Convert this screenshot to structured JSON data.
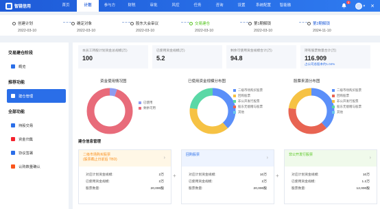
{
  "app": {
    "logo": "智链信用"
  },
  "nav": [
    "首页",
    "计划",
    "参与方",
    "财税",
    "审批",
    "风控",
    "任务",
    "咨询",
    "设置",
    "系统配置",
    "智能融"
  ],
  "header": {
    "bell_count": "5",
    "close_symbol": "✕",
    "caret": "▾"
  },
  "steps": [
    {
      "title": "创建计划",
      "date": "2022-03-10",
      "state": ""
    },
    {
      "title": "确定对象",
      "date": "2022-03-10",
      "state": ""
    },
    {
      "title": "股东大会审议",
      "date": "2022-03-10",
      "state": ""
    },
    {
      "title": "交易建仓",
      "date": "2022-03-10",
      "state": "done"
    },
    {
      "title": "第1期解锁",
      "date": "2022-03-10",
      "state": ""
    },
    {
      "title": "第2期解锁",
      "date": "2024-11-10",
      "state": "cur"
    }
  ],
  "sidebar": {
    "group1": "交易建仓阶段",
    "group2": "推荐功能",
    "group3": "全部功能",
    "items": [
      {
        "label": "概览",
        "group": 1,
        "color": "#2a6ee8",
        "icon": "home-icon"
      },
      {
        "label": "建仓管理",
        "group": 2,
        "color": "#ffffff",
        "icon": "grid-icon",
        "active": true
      },
      {
        "label": "持股交易",
        "group": 3,
        "color": "#2a6ee8",
        "icon": "trade-icon"
      },
      {
        "label": "资金归集",
        "group": 3,
        "color": "#f5222d",
        "icon": "fund-icon"
      },
      {
        "label": "协议签署",
        "group": 3,
        "color": "#2a6ee8",
        "icon": "sign-icon"
      },
      {
        "label": "认购数量确认",
        "group": 3,
        "color": "#fa541c",
        "icon": "confirm-icon"
      }
    ]
  },
  "stats": [
    {
      "label": "本员工持股计划资金总规模(万)",
      "value": "100",
      "sub": ""
    },
    {
      "label": "已使用资金规模(万)",
      "value": "5.2",
      "sub": ""
    },
    {
      "label": "剩余可使用资金规模合计(万)",
      "value": "94.8",
      "sub": ""
    },
    {
      "label": "持有股票数量合计(万)",
      "value": "116.909",
      "sub": "占公司总股本约1.04%"
    }
  ],
  "charts": [
    {
      "title": "资金使用情况图",
      "legend": [
        "已使用",
        "剩余可用"
      ]
    },
    {
      "title": "已使用资金规模分布图",
      "legend": [
        "二级市场购买股票",
        "回购股票",
        "非公开发行股票",
        "股东无偿赠与股票",
        "其他"
      ]
    },
    {
      "title": "股票来源分布图",
      "legend": [
        "二级市场购买股票",
        "回购股票",
        "非公开发行股票",
        "股东无偿赠与股票",
        "其他"
      ]
    }
  ],
  "chart_data": [
    {
      "type": "pie",
      "title": "资金使用情况图",
      "categories": [
        "已使用",
        "剩余可用"
      ],
      "values": [
        5.2,
        94.8
      ]
    },
    {
      "type": "pie",
      "title": "已使用资金规模分布图",
      "categories": [
        "二级市场购买股票",
        "回购股票",
        "非公开发行股票"
      ],
      "values": [
        2,
        2,
        1.2
      ]
    },
    {
      "type": "pie",
      "title": "股票来源分布图",
      "categories": [
        "二级市场购买股票",
        "回购股票",
        "非公开发行股票"
      ],
      "values": [
        20000,
        20000,
        12000
      ]
    }
  ],
  "section": {
    "title": "建仓信息管理"
  },
  "cards": [
    {
      "head1": "二级市场购买股票",
      "head2": "(股票截止日前后 TBD)",
      "head_color": "#fff7e6",
      "text_color": "#fa8c16",
      "rows": [
        [
          "对应计划资金规模:",
          "2万"
        ],
        [
          "已使用资金规模:",
          "2万"
        ],
        [
          "股票数量:",
          "20,000股"
        ]
      ]
    },
    {
      "head1": "回购股票",
      "head2": "",
      "head_color": "#eef4ff",
      "text_color": "#2a6ee8",
      "rows": [
        [
          "对应计划资金规模:",
          "10万"
        ],
        [
          "已使用资金规模:",
          "2万"
        ],
        [
          "股票数量:",
          "20,000股"
        ]
      ]
    },
    {
      "head1": "非公开发行股票",
      "head2": "",
      "head_color": "#f0faeb",
      "text_color": "#52c41a",
      "rows": [
        [
          "对应计划资金规模:",
          "10万"
        ],
        [
          "已使用资金规模:",
          "1.2万"
        ],
        [
          "股票数量:",
          "12,000股"
        ]
      ]
    }
  ],
  "card_arrow": "›"
}
